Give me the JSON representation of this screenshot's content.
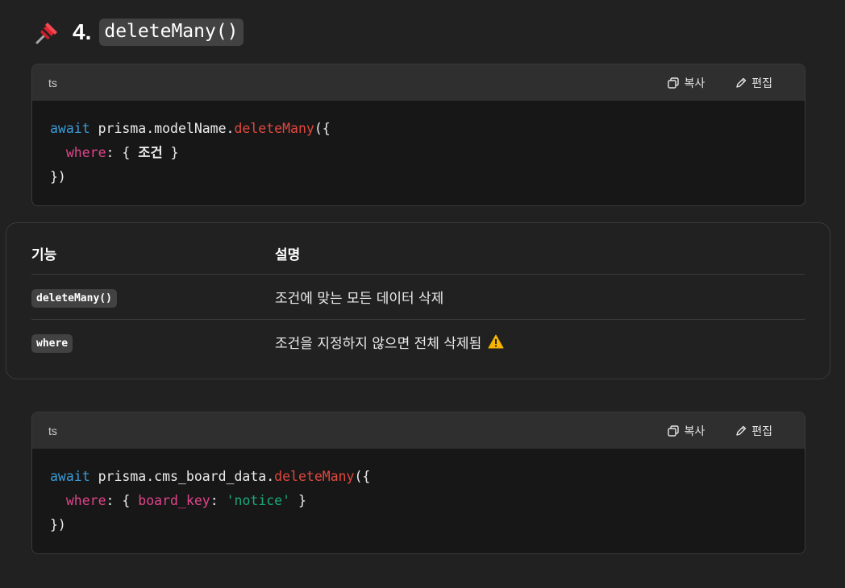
{
  "heading": {
    "number": "4.",
    "code": "deleteMany()"
  },
  "codeblock_actions": {
    "copy_label": "복사",
    "edit_label": "편집"
  },
  "code1": {
    "lang": "ts",
    "line1": {
      "kw": "await",
      "obj": "prisma.modelName.",
      "fn": "deleteMany",
      "rest": "({"
    },
    "line2": {
      "prop": "where",
      "colon": ": { ",
      "value": "조건",
      "close": " }"
    },
    "line3": "})"
  },
  "table": {
    "headers": [
      "기능",
      "설명"
    ],
    "rows": [
      {
        "code": "deleteMany()",
        "desc": "조건에 맞는 모든 데이터 삭제"
      },
      {
        "code": "where",
        "desc": "조건을 지정하지 않으면 전체 삭제됨"
      }
    ]
  },
  "code2": {
    "lang": "ts",
    "line1": {
      "kw": "await",
      "obj": "prisma.cms_board_data.",
      "fn": "deleteMany",
      "rest": "({"
    },
    "line2": {
      "prop": "where",
      "colon": ": { ",
      "key": "board_key",
      "colon2": ": ",
      "str": "'notice'",
      "close": " }"
    },
    "line3": "})"
  },
  "icons": {
    "heading": "pushpin-icon",
    "copy": "copy-icon",
    "edit": "pencil-icon",
    "warning": "warning-icon"
  },
  "colors": {
    "background": "#212121",
    "code_bg": "#171717",
    "code_header": "#2f2f2f",
    "keyword": "#3a9bd9",
    "function": "#e0483f",
    "property": "#e0458b",
    "string": "#19a97b",
    "warning": "#f4b400"
  }
}
